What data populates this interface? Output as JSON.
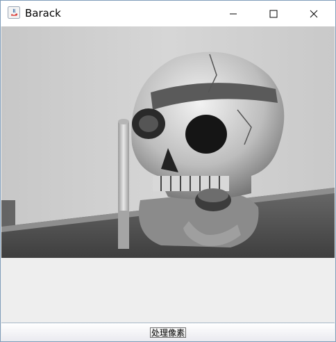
{
  "window": {
    "title": "Barack",
    "controls": [
      "minimize",
      "maximize",
      "close"
    ]
  },
  "content": {
    "image_description_icon": "grayscale-skull-image"
  },
  "actions": {
    "process_button_label": "处理像素"
  }
}
